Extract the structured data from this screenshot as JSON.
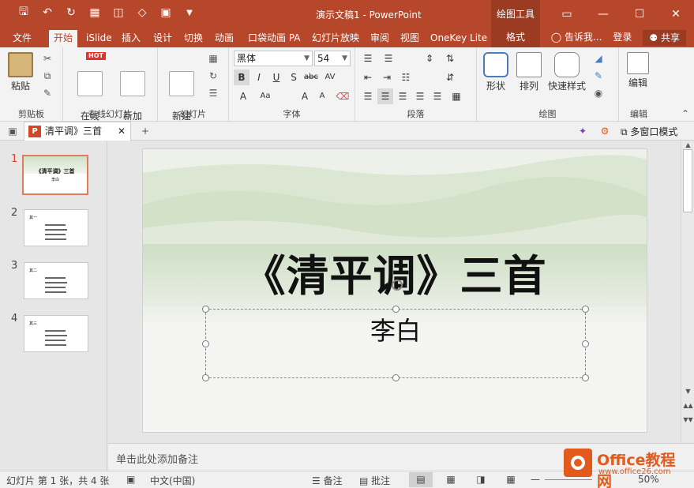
{
  "app": {
    "title": "演示文稿1 - PowerPoint",
    "context_tool": "绘图工具",
    "accent": "#b7472a"
  },
  "qat": {
    "icons": [
      "save-icon",
      "undo-icon",
      "redo-icon",
      "present-icon",
      "new-slide-icon",
      "shape-icon",
      "image-icon",
      "customize-icon"
    ]
  },
  "tabs": [
    "文件",
    "开始",
    "iSlide",
    "插入",
    "设计",
    "切换",
    "动画",
    "口袋动画 PA",
    "幻灯片放映",
    "审阅",
    "视图",
    "OneKey Lite",
    "格式"
  ],
  "tab_active": "开始",
  "tab_right": {
    "tell_me": "告诉我...",
    "login": "登录",
    "share": "共享"
  },
  "ribbon": {
    "clipboard": {
      "label": "剪贴板",
      "paste": "粘贴"
    },
    "online_slides": {
      "label": "在线幻灯片",
      "online_slides_btn": "在线\n幻灯片",
      "new_anim_page": "新加\n动画页",
      "hot": "HOT"
    },
    "slides": {
      "label": "幻灯片",
      "new_slide": "新建\n幻灯片"
    },
    "font": {
      "label": "字体",
      "font_name": "黑体",
      "font_size": "54"
    },
    "paragraph": {
      "label": "段落"
    },
    "drawing": {
      "label": "绘图",
      "shape": "形状",
      "arrange": "排列",
      "quick_style": "快速样式"
    },
    "editing": {
      "label": "编辑",
      "edit": "编辑"
    }
  },
  "doc_tab": {
    "name": "清平调》三首",
    "badge": "P",
    "multiwindow": "多窗口模式"
  },
  "thumbnails": [
    {
      "num": "1",
      "title": "《清平调》三首",
      "sub": "李白"
    },
    {
      "num": "2",
      "heading": "其一"
    },
    {
      "num": "3",
      "heading": "其二"
    },
    {
      "num": "4",
      "heading": "其三"
    }
  ],
  "slide": {
    "title": "《清平调》三首",
    "subtitle": "李白"
  },
  "notes": {
    "placeholder": "单击此处添加备注"
  },
  "status": {
    "slide_info": "幻灯片 第 1 张，共 4 张",
    "language": "中文(中国)",
    "notes": "备注",
    "comments": "批注",
    "zoom": "50%"
  },
  "watermark": {
    "brand": "Office教程网",
    "url": "www.office26.com"
  }
}
